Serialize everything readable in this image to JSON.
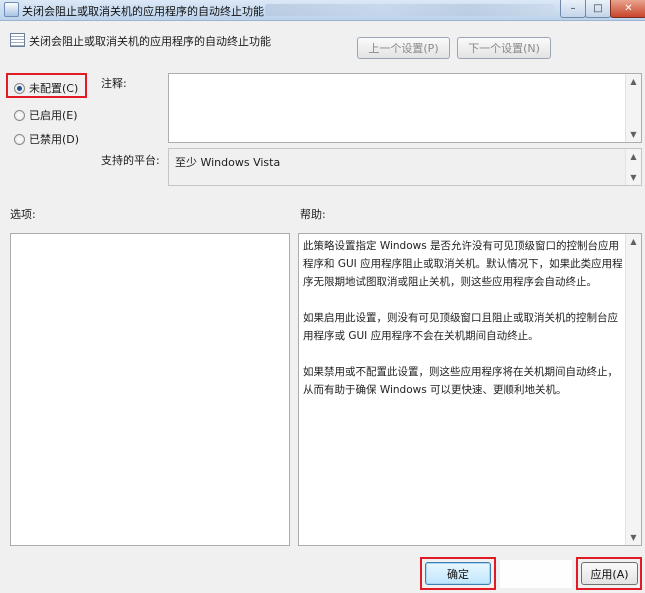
{
  "window": {
    "title": "关闭会阻止或取消关机的应用程序的自动终止功能",
    "controls": {
      "minimize": "–",
      "maximize": "□",
      "close": "✕"
    }
  },
  "header": {
    "policy_name": "关闭会阻止或取消关机的应用程序的自动终止功能",
    "prev_button": "上一个设置(P)",
    "next_button": "下一个设置(N)"
  },
  "state": {
    "options": [
      {
        "label": "未配置(C)",
        "checked": true
      },
      {
        "label": "已启用(E)",
        "checked": false
      },
      {
        "label": "已禁用(D)",
        "checked": false
      }
    ]
  },
  "comment": {
    "label": "注释:",
    "value": ""
  },
  "platform": {
    "label": "支持的平台:",
    "value": "至少 Windows Vista"
  },
  "options_panel": {
    "label": "选项:"
  },
  "help_panel": {
    "label": "帮助:",
    "paragraphs": [
      "此策略设置指定 Windows 是否允许没有可见顶级窗口的控制台应用程序和 GUI 应用程序阻止或取消关机。默认情况下，如果此类应用程序无限期地试图取消或阻止关机，则这些应用程序会自动终止。",
      "如果启用此设置，则没有可见顶级窗口且阻止或取消关机的控制台应用程序或 GUI 应用程序不会在关机期间自动终止。",
      "如果禁用或不配置此设置，则这些应用程序将在关机期间自动终止，从而有助于确保 Windows 可以更快速、更顺利地关机。"
    ]
  },
  "footer": {
    "ok_button": "确定",
    "apply_button": "应用(A)"
  },
  "colors": {
    "highlight_border": "#e01b24",
    "accent": "#1e4f8a"
  }
}
